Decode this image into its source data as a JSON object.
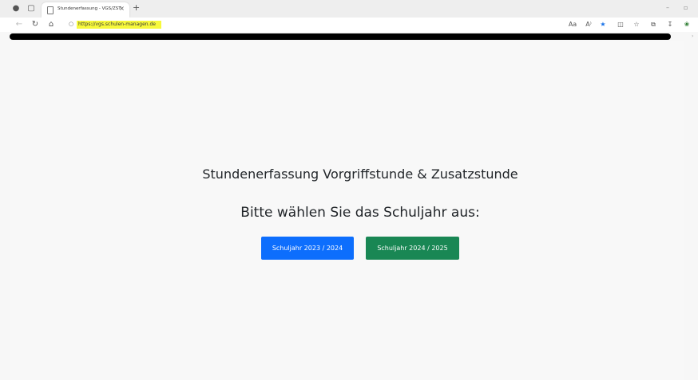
{
  "browser": {
    "tab": {
      "title": "Stundenerfassung - VGS/ZST",
      "close": "×"
    },
    "new_tab": "+",
    "window_controls": {
      "minimize": "–",
      "maximize": "▫"
    },
    "address": {
      "url": "https://vgs.schulen-managen.de"
    },
    "toolbar_icons": {
      "translate": "Aa",
      "read_aloud": "A⁾"
    }
  },
  "page": {
    "heading": "Stundenerfassung Vorgriffstunde & Zusatzstunde",
    "subheading": "Bitte wählen Sie das Schuljahr aus:",
    "buttons": {
      "year_2023": "Schuljahr 2023 / 2024",
      "year_2024": "Schuljahr 2024 / 2025"
    }
  },
  "colors": {
    "primary_button": "#0d6efd",
    "success_button": "#198754",
    "url_highlight": "#f7f93b"
  }
}
